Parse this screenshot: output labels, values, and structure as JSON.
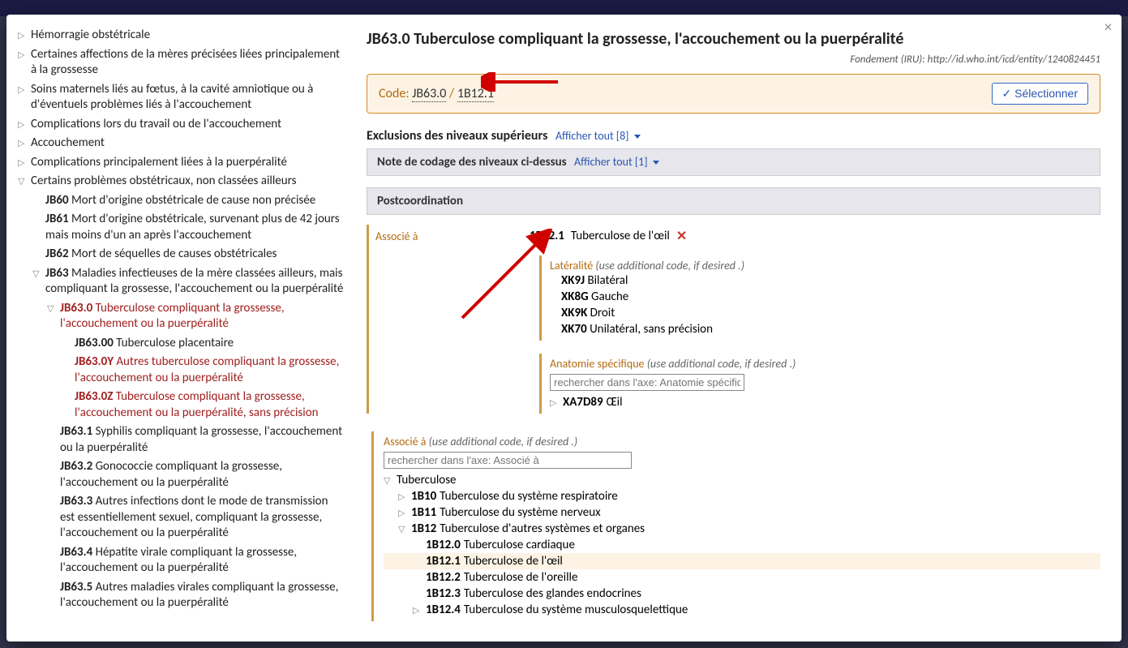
{
  "tree": [
    {
      "indent": 0,
      "toggle": "▷",
      "code": "",
      "label": "Hémorragie obstétricale"
    },
    {
      "indent": 0,
      "toggle": "▷",
      "code": "",
      "label": "Certaines affections de la mères précisées liées principalement à la grossesse"
    },
    {
      "indent": 0,
      "toggle": "▷",
      "code": "",
      "label": "Soins maternels liés au fœtus, à la cavité amniotique ou à d'éventuels problèmes liés à l'accouchement"
    },
    {
      "indent": 0,
      "toggle": "▷",
      "code": "",
      "label": "Complications lors du travail ou de l'accouchement"
    },
    {
      "indent": 0,
      "toggle": "▷",
      "code": "",
      "label": "Accouchement"
    },
    {
      "indent": 0,
      "toggle": "▷",
      "code": "",
      "label": "Complications principalement liées à la puerpéralité"
    },
    {
      "indent": 0,
      "toggle": "▽",
      "code": "",
      "label": "Certains problèmes obstétricaux, non classées ailleurs"
    },
    {
      "indent": 1,
      "toggle": "",
      "code": "JB60",
      "label": " Mort d'origine obstétricale de cause non précisée"
    },
    {
      "indent": 1,
      "toggle": "",
      "code": "JB61",
      "label": " Mort d'origine obstétricale, survenant plus de 42 jours mais moins d'un an après l'accouchement"
    },
    {
      "indent": 1,
      "toggle": "",
      "code": "JB62",
      "label": " Mort de séquelles de causes obstétricales"
    },
    {
      "indent": 1,
      "toggle": "▽",
      "code": "JB63",
      "label": " Maladies infectieuses de la mère classées ailleurs, mais compliquant la grossesse, l'accouchement ou la puerpéralité"
    },
    {
      "indent": 2,
      "toggle": "▽",
      "code": "JB63.0",
      "label": " Tuberculose compliquant la grossesse, l'accouchement ou la puerpéralité",
      "red": true
    },
    {
      "indent": 3,
      "toggle": "",
      "code": "JB63.00",
      "label": " Tuberculose placentaire"
    },
    {
      "indent": 3,
      "toggle": "",
      "code": "JB63.0Y",
      "label": " Autres tuberculose compliquant la grossesse, l'accouchement ou la puerpéralité",
      "red": true
    },
    {
      "indent": 3,
      "toggle": "",
      "code": "JB63.0Z",
      "label": " Tuberculose compliquant la grossesse, l'accouchement ou la puerpéralité, sans précision",
      "red": true
    },
    {
      "indent": 2,
      "toggle": "",
      "code": "JB63.1",
      "label": " Syphilis compliquant la grossesse, l'accouchement ou la puerpéralité"
    },
    {
      "indent": 2,
      "toggle": "",
      "code": "JB63.2",
      "label": " Gonococcie compliquant la grossesse, l'accouchement ou la puerpéralité"
    },
    {
      "indent": 2,
      "toggle": "",
      "code": "JB63.3",
      "label": " Autres infections dont le mode de transmission est essentiellement sexuel, compliquant la grossesse, l'accouchement ou la puerpéralité"
    },
    {
      "indent": 2,
      "toggle": "",
      "code": "JB63.4",
      "label": " Hépatite virale compliquant la grossesse, l'accouchement ou la puerpéralité"
    },
    {
      "indent": 2,
      "toggle": "",
      "code": "JB63.5",
      "label": " Autres maladies virales compliquant la grossesse, l'accouchement ou la puerpéralité"
    }
  ],
  "header": {
    "title": "JB63.0 Tuberculose compliquant la grossesse, l'accouchement ou la puerpéralité",
    "fondement_label": "Fondement (IRU): ",
    "fondement_uri": "http://id.who.int/icd/entity/1240824451"
  },
  "codebox": {
    "prefix": "Code: ",
    "code1": "JB63.0",
    "slash": " / ",
    "code2": "1B12.1",
    "select": "✓ Sélectionner"
  },
  "exclusions": {
    "label": "Exclusions des niveaux supérieurs",
    "toggle": "Afficher tout [8]"
  },
  "codingnote": {
    "label": "Note de codage des niveaux ci-dessus",
    "toggle": "Afficher tout [1]"
  },
  "postcoord": {
    "heading": "Postcoordination",
    "associe_a": "Associé à",
    "selected_code": "1B12.1",
    "selected_label": "Tuberculose de l'œil",
    "laterality": {
      "title": "Latéralité",
      "hint": "(use additional code, if desired .)",
      "options": [
        {
          "code": "XK9J",
          "label": " Bilatéral"
        },
        {
          "code": "XK8G",
          "label": " Gauche"
        },
        {
          "code": "XK9K",
          "label": " Droit"
        },
        {
          "code": "XK70",
          "label": " Unilatéral, sans précision"
        }
      ]
    },
    "anatomy": {
      "title": "Anatomie spécifique",
      "hint": "(use additional code, if desired .)",
      "placeholder": "rechercher dans l'axe: Anatomie spécifique",
      "tree": [
        {
          "toggle": "▷",
          "code": "XA7D89",
          "label": " Œil"
        }
      ]
    }
  },
  "assoc": {
    "title": "Associé à",
    "hint": "(use additional code, if desired .)",
    "placeholder": "rechercher dans l'axe: Associé à",
    "tree": [
      {
        "indent": 0,
        "toggle": "▽",
        "code": "",
        "label": "Tuberculose"
      },
      {
        "indent": 1,
        "toggle": "▷",
        "code": "1B10",
        "label": " Tuberculose du système respiratoire"
      },
      {
        "indent": 1,
        "toggle": "▷",
        "code": "1B11",
        "label": " Tuberculose du système nerveux"
      },
      {
        "indent": 1,
        "toggle": "▽",
        "code": "1B12",
        "label": " Tuberculose d'autres systèmes et organes"
      },
      {
        "indent": 2,
        "toggle": "",
        "code": "1B12.0",
        "label": " Tuberculose cardiaque"
      },
      {
        "indent": 2,
        "toggle": "",
        "code": "1B12.1",
        "label": " Tuberculose de l'œil",
        "highlight": true
      },
      {
        "indent": 2,
        "toggle": "",
        "code": "1B12.2",
        "label": " Tuberculose de l'oreille"
      },
      {
        "indent": 2,
        "toggle": "",
        "code": "1B12.3",
        "label": " Tuberculose des glandes endocrines"
      },
      {
        "indent": 2,
        "toggle": "▷",
        "code": "1B12.4",
        "label": " Tuberculose du système musculosquelettique"
      }
    ]
  }
}
